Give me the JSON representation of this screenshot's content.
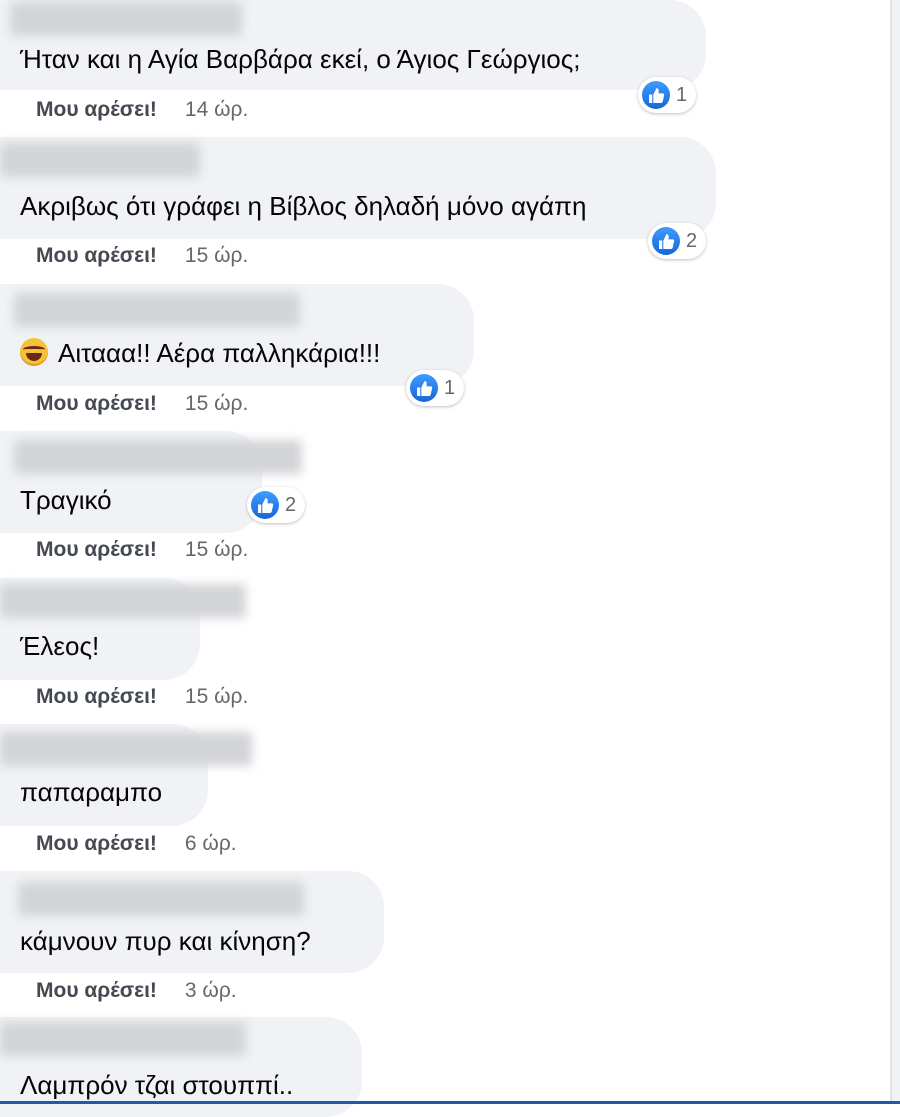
{
  "comments": [
    {
      "text": "Ήταν και η Αγία Βαρβάρα εκεί, ο Άγιος Γεώργιος;",
      "like_label": "Μου αρέσει!",
      "time": "14 ώρ.",
      "reactions": "1"
    },
    {
      "text": "Ακριβως ότι γράφει η Βίβλος δηλαδή μόνο αγάπη",
      "like_label": "Μου αρέσει!",
      "time": "15 ώρ.",
      "reactions": "2"
    },
    {
      "text": "Αιτααα!! Αέρα παλληκάρια!!!",
      "emoji": "laughing-face",
      "like_label": "Μου αρέσει!",
      "time": "15 ώρ.",
      "reactions": "1"
    },
    {
      "text": "Τραγικό",
      "like_label": "Μου αρέσει!",
      "time": "15 ώρ.",
      "reactions": "2"
    },
    {
      "text": "Έλεος!",
      "like_label": "Μου αρέσει!",
      "time": "15 ώρ."
    },
    {
      "text": "παπαραμπο",
      "like_label": "Μου αρέσει!",
      "time": "6 ώρ."
    },
    {
      "text": "κάμνουν πυρ και κίνηση?",
      "like_label": "Μου αρέσει!",
      "time": "3 ώρ."
    },
    {
      "text": "Λαμπρόν τζαι στουππί.."
    }
  ],
  "icons": {
    "reaction": "like-thumb-icon",
    "emoji": "laughing-face-icon"
  },
  "colors": {
    "bubble": "#f0f2f5",
    "like_blue": "#1877f2",
    "meta_text": "#65676b"
  }
}
